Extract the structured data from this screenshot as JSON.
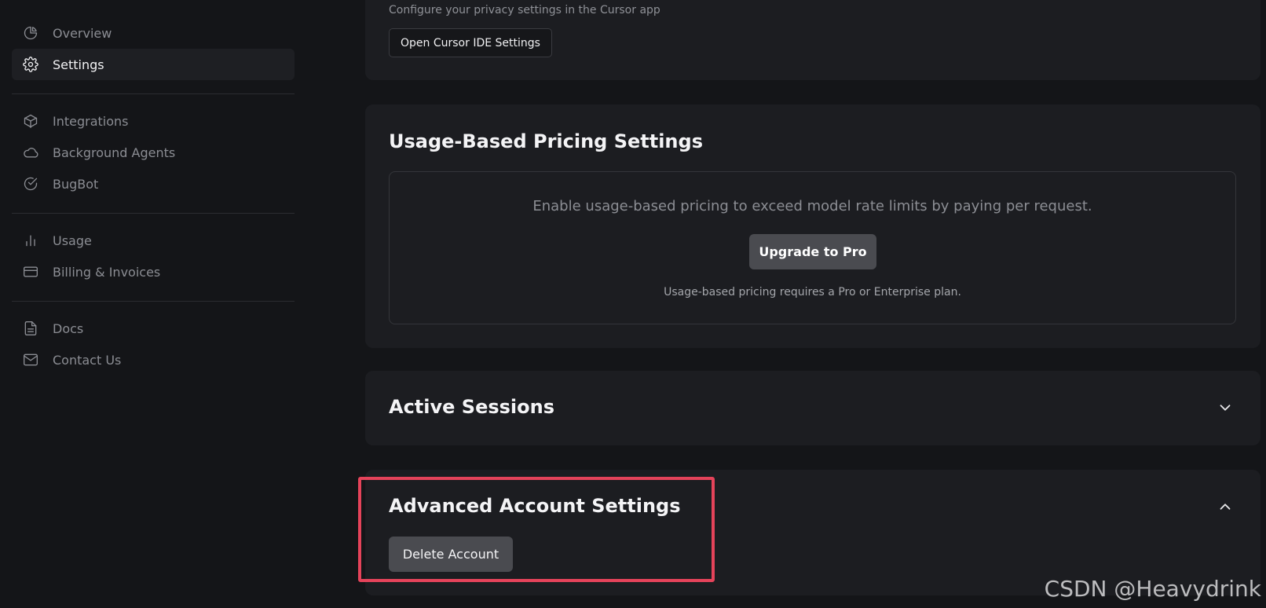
{
  "sidebar": {
    "groups": [
      [
        {
          "label": "Overview",
          "icon": "pie-chart-icon",
          "active": false
        },
        {
          "label": "Settings",
          "icon": "gear-icon",
          "active": true
        }
      ],
      [
        {
          "label": "Integrations",
          "icon": "cube-icon",
          "active": false
        },
        {
          "label": "Background Agents",
          "icon": "cloud-icon",
          "active": false
        },
        {
          "label": "BugBot",
          "icon": "check-circle-icon",
          "active": false
        }
      ],
      [
        {
          "label": "Usage",
          "icon": "bar-chart-icon",
          "active": false
        },
        {
          "label": "Billing & Invoices",
          "icon": "credit-card-icon",
          "active": false
        }
      ],
      [
        {
          "label": "Docs",
          "icon": "document-icon",
          "active": false
        },
        {
          "label": "Contact Us",
          "icon": "mail-icon",
          "active": false
        }
      ]
    ]
  },
  "privacy": {
    "description": "Configure your privacy settings in the Cursor app",
    "button_label": "Open Cursor IDE Settings"
  },
  "usage_pricing": {
    "title": "Usage-Based Pricing Settings",
    "message": "Enable usage-based pricing to exceed model rate limits by paying per request.",
    "button_label": "Upgrade to Pro",
    "note": "Usage-based pricing requires a Pro or Enterprise plan."
  },
  "sessions": {
    "title": "Active Sessions",
    "expanded": false
  },
  "advanced": {
    "title": "Advanced Account Settings",
    "button_label": "Delete Account",
    "expanded": true
  },
  "watermark": "CSDN @Heavydrink",
  "colors": {
    "background": "#141518",
    "card": "#1c1d21",
    "highlight": "#e5435a",
    "button": "#4a4b50"
  }
}
